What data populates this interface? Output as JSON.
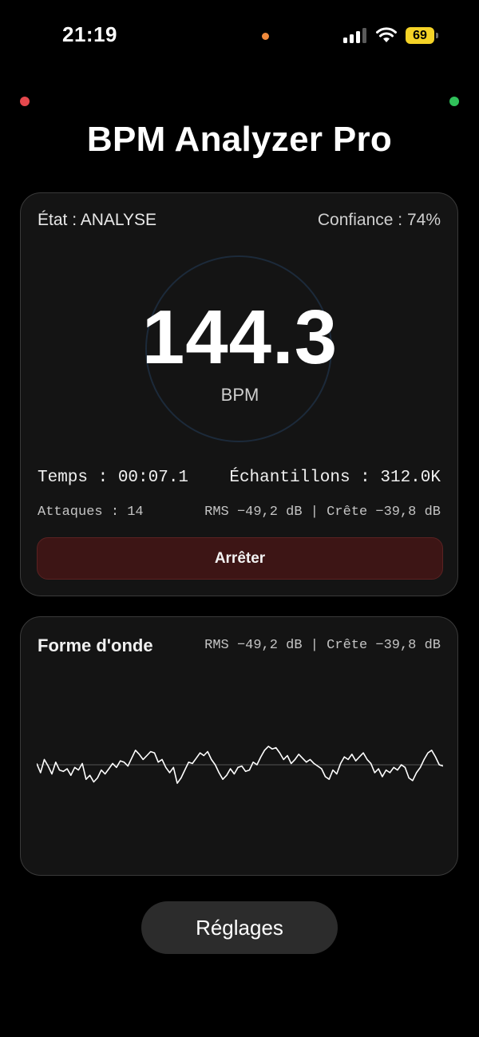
{
  "status_bar": {
    "time": "21:19",
    "battery_level": "69",
    "icons": [
      "cellular-signal-icon",
      "wifi-icon",
      "battery-icon"
    ]
  },
  "title": "BPM Analyzer Pro",
  "analysis": {
    "state": "État : ANALYSE",
    "confidence": "Confiance : 74%",
    "bpm": "144.3",
    "bpm_unit": "BPM",
    "time_label": "Temps : 00:07.1",
    "samples_label": "Échantillons : 312.0K",
    "onsets_label": "Attaques : 14",
    "levels_label": "RMS −49,2 dB | Crête −39,8 dB",
    "stop_button": "Arrêter"
  },
  "waveform": {
    "title": "Forme d'onde",
    "levels_label": "RMS −49,2 dB | Crête −39,8 dB",
    "samples": [
      0.05,
      -0.3,
      0.2,
      -0.05,
      -0.35,
      0.1,
      -0.2,
      -0.25,
      -0.15,
      -0.4,
      -0.1,
      -0.2,
      0.05,
      -0.55,
      -0.4,
      -0.65,
      -0.5,
      -0.2,
      -0.35,
      -0.15,
      0.05,
      -0.1,
      0.15,
      0.1,
      -0.05,
      0.25,
      0.55,
      0.4,
      0.2,
      0.35,
      0.5,
      0.45,
      0.1,
      0.2,
      -0.1,
      -0.3,
      -0.1,
      -0.7,
      -0.5,
      -0.2,
      0.1,
      0.05,
      0.25,
      0.45,
      0.35,
      0.5,
      0.2,
      0.0,
      -0.3,
      -0.55,
      -0.4,
      -0.15,
      -0.35,
      -0.1,
      -0.05,
      -0.25,
      -0.2,
      0.1,
      0.0,
      0.3,
      0.55,
      0.7,
      0.6,
      0.65,
      0.45,
      0.2,
      0.35,
      0.05,
      0.2,
      0.4,
      0.25,
      0.1,
      0.2,
      0.05,
      -0.05,
      -0.15,
      -0.45,
      -0.55,
      -0.2,
      -0.35,
      0.05,
      0.3,
      0.2,
      0.4,
      0.15,
      0.3,
      0.45,
      0.2,
      0.05,
      -0.3,
      -0.15,
      -0.45,
      -0.2,
      -0.3,
      -0.1,
      -0.2,
      0.0,
      -0.1,
      -0.5,
      -0.6,
      -0.3,
      -0.1,
      0.2,
      0.45,
      0.55,
      0.3,
      0.0,
      -0.05
    ]
  },
  "settings_button": "Réglages",
  "colors": {
    "background": "#000000",
    "card": "#141414",
    "stop_button": "#3d1515",
    "bpm_ring": "#1c2a3a",
    "orange_indicator": "#f08a3c",
    "red_indicator": "#e5484d",
    "green_indicator": "#30c15a",
    "battery": "#f5d327",
    "waveform_line": "#ffffff",
    "baseline": "#555555"
  }
}
